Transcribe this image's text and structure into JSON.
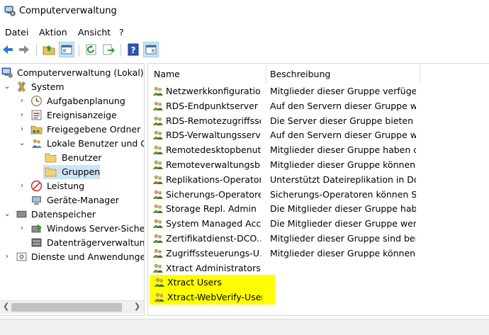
{
  "window": {
    "title": "Computerverwaltung",
    "icon": "computer-management-icon"
  },
  "menu": [
    "Datei",
    "Aktion",
    "Ansicht",
    "?"
  ],
  "toolbar": [
    "back-icon",
    "forward-icon",
    "up-folder-icon",
    "show-hide-tree-icon",
    "refresh-icon",
    "export-list-icon",
    "help-icon",
    "show-hide-action-pane-icon"
  ],
  "tree": {
    "items": [
      {
        "label": "Computerverwaltung (Lokal)",
        "icon": "computer-management-icon"
      },
      {
        "label": "System",
        "icon": "tools-icon"
      },
      {
        "label": "Aufgabenplanung",
        "icon": "clock-icon"
      },
      {
        "label": "Ereignisanzeige",
        "icon": "event-viewer-icon"
      },
      {
        "label": "Freigegebene Ordner",
        "icon": "shared-folder-icon"
      },
      {
        "label": "Lokale Benutzer und Gruppen",
        "icon": "users-icon"
      },
      {
        "label": "Benutzer",
        "icon": "folder-icon"
      },
      {
        "label": "Gruppen",
        "icon": "folder-icon"
      },
      {
        "label": "Leistung",
        "icon": "performance-icon"
      },
      {
        "label": "Geräte-Manager",
        "icon": "device-manager-icon"
      },
      {
        "label": "Datenspeicher",
        "icon": "storage-icon"
      },
      {
        "label": "Windows Server-Sicherung",
        "icon": "backup-icon"
      },
      {
        "label": "Datenträgerverwaltung",
        "icon": "disk-icon"
      },
      {
        "label": "Dienste und Anwendungen",
        "icon": "services-icon"
      }
    ],
    "selected": "Gruppen"
  },
  "list": {
    "columns": [
      "Name",
      "Beschreibung"
    ],
    "rows": [
      {
        "name": "Netzwerkkonfiguratio...",
        "description": "Mitglieder dieser Gruppe verfügen..."
      },
      {
        "name": "RDS-Endpunktserver",
        "description": "Auf den Servern dieser Gruppe wer..."
      },
      {
        "name": "RDS-Remotezugriffsse...",
        "description": "Die Server dieser Gruppe bieten Be..."
      },
      {
        "name": "RDS-Verwaltungsserver",
        "description": "Auf den Servern dieser Gruppe wer..."
      },
      {
        "name": "Remotedesktopbenutz...",
        "description": "Mitglieder dieser Gruppe haben di..."
      },
      {
        "name": "Remoteverwaltungsbe...",
        "description": "Mitglieder dieser Gruppe können ..."
      },
      {
        "name": "Replikations-Operator",
        "description": "Unterstützt Dateireplikation in Do..."
      },
      {
        "name": "Sicherungs-Operatoren",
        "description": "Sicherungs-Operatoren können Si..."
      },
      {
        "name": "Storage Repl. Admin",
        "description": "Die Mitglieder dieser Gruppe habe..."
      },
      {
        "name": "System Managed Acco...",
        "description": "Die Mitglieder dieser Gruppe werd..."
      },
      {
        "name": "Zertifikatdienst-DCO...",
        "description": "Mitglieder dieser Gruppe sind ber..."
      },
      {
        "name": "Zugriffssteuerungs-U...",
        "description": "Mitglieder dieser Gruppe können r..."
      },
      {
        "name": "Xtract Administrators",
        "description": ""
      },
      {
        "name": "Xtract Users",
        "description": ""
      },
      {
        "name": "Xtract-WebVerify-Users",
        "description": ""
      }
    ],
    "highlight_color": "#ffff00"
  },
  "colors": {
    "selection": "#cce4f7",
    "accent": "#0078d7"
  }
}
